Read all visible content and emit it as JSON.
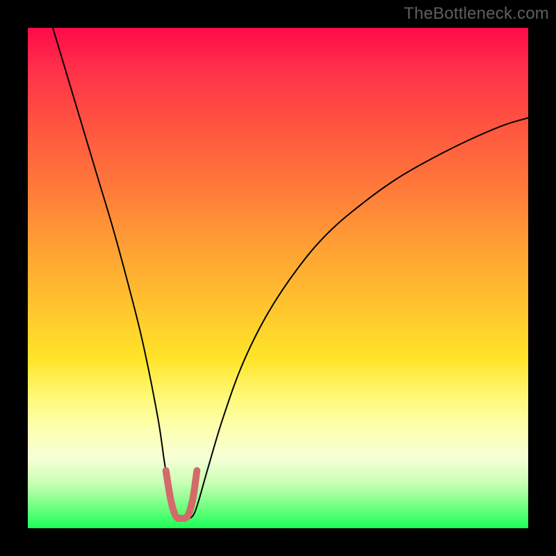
{
  "watermark": {
    "text": "TheBottleneck.com"
  },
  "chart_data": {
    "type": "line",
    "title": "",
    "xlabel": "",
    "ylabel": "",
    "xlim": [
      0,
      100
    ],
    "ylim": [
      0,
      100
    ],
    "grid": false,
    "legend": false,
    "series": [
      {
        "name": "bottleneck-curve",
        "color": "#000000",
        "stroke_width": 2,
        "x": [
          5,
          8,
          11,
          14,
          17,
          20,
          23,
          26,
          27.5,
          29,
          30,
          31,
          32,
          33,
          34,
          36,
          39,
          43,
          48,
          54,
          60,
          67,
          74,
          81,
          88,
          95,
          100
        ],
        "y": [
          100,
          90,
          80,
          70,
          60,
          49,
          37,
          22,
          12,
          5,
          2.5,
          2,
          2,
          2.5,
          5,
          12,
          22,
          33,
          43,
          52,
          59,
          65,
          70,
          74,
          77.5,
          80.5,
          82
        ]
      },
      {
        "name": "bottom-highlight",
        "color": "#d46a6a",
        "stroke_width": 10,
        "x": [
          27.6,
          28.5,
          29.3,
          30,
          30.8,
          31.5,
          32.2,
          33,
          33.8
        ],
        "y": [
          11.5,
          6,
          3,
          2,
          2,
          2,
          3,
          6,
          11.5
        ]
      }
    ],
    "background_gradient": {
      "direction": "vertical",
      "stops": [
        {
          "pos": 0.0,
          "color": "#ff0a4a"
        },
        {
          "pos": 0.2,
          "color": "#ff5640"
        },
        {
          "pos": 0.44,
          "color": "#ffa134"
        },
        {
          "pos": 0.66,
          "color": "#ffe428"
        },
        {
          "pos": 0.86,
          "color": "#f6ffd6"
        },
        {
          "pos": 1.0,
          "color": "#1bff57"
        }
      ]
    }
  }
}
